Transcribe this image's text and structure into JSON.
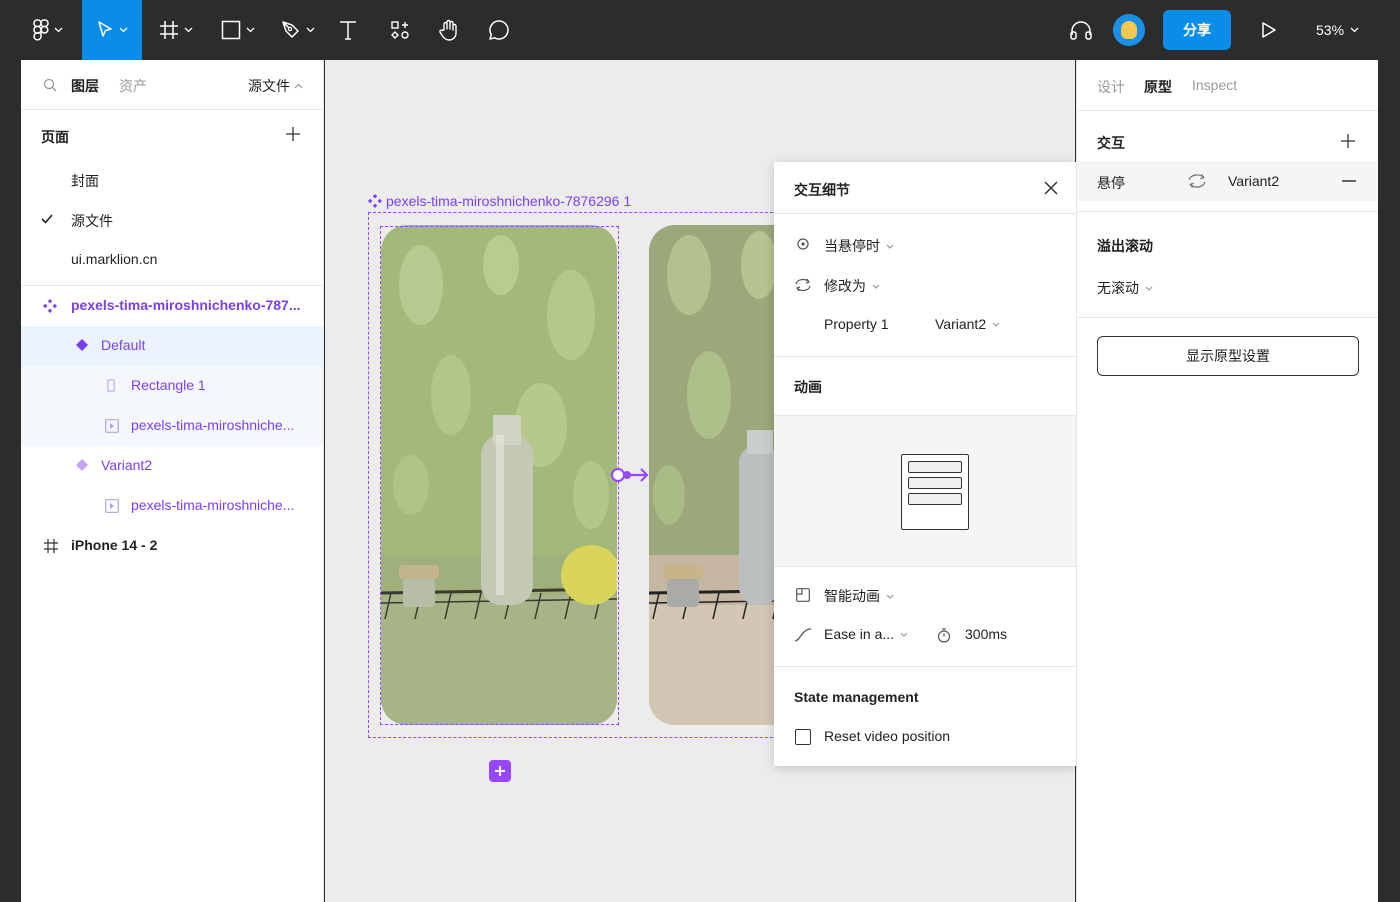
{
  "toolbar": {
    "share_label": "分享",
    "zoom": "53%",
    "tools": [
      "figma-menu",
      "move",
      "frame",
      "shape",
      "pen",
      "text",
      "resources",
      "hand",
      "comment"
    ]
  },
  "left_panel": {
    "tabs": {
      "layers": "图层",
      "assets": "资产"
    },
    "source_file": "源文件",
    "pages_title": "页面",
    "pages": [
      "封面",
      "源文件",
      "ui.marklion.cn"
    ],
    "layers": {
      "component_set": "pexels-tima-miroshnichenko-787...",
      "default": "Default",
      "rectangle": "Rectangle 1",
      "image_1": "pexels-tima-miroshniche...",
      "variant2": "Variant2",
      "image_2": "pexels-tima-miroshniche...",
      "frame": "iPhone 14 - 2"
    }
  },
  "canvas": {
    "component_label": "pexels-tima-miroshnichenko-7876296 1"
  },
  "popover": {
    "title": "交互细节",
    "trigger": "当悬停时",
    "action": "修改为",
    "property_name": "Property 1",
    "property_value": "Variant2",
    "animation_title": "动画",
    "animation_type": "智能动画",
    "easing": "Ease in a...",
    "duration": "300ms",
    "state_title": "State management",
    "reset_label": "Reset video position"
  },
  "right_panel": {
    "tabs": {
      "design": "设计",
      "prototype": "原型",
      "inspect": "Inspect"
    },
    "interactions_title": "交互",
    "interaction_trigger": "悬停",
    "interaction_dest": "Variant2",
    "overflow_title": "溢出滚动",
    "overflow_value": "无滚动",
    "show_settings": "显示原型设置"
  },
  "colors": {
    "accent_blue": "#0c8ce9",
    "component_purple": "#9747ff",
    "toolbar_bg": "#2c2c2c"
  }
}
